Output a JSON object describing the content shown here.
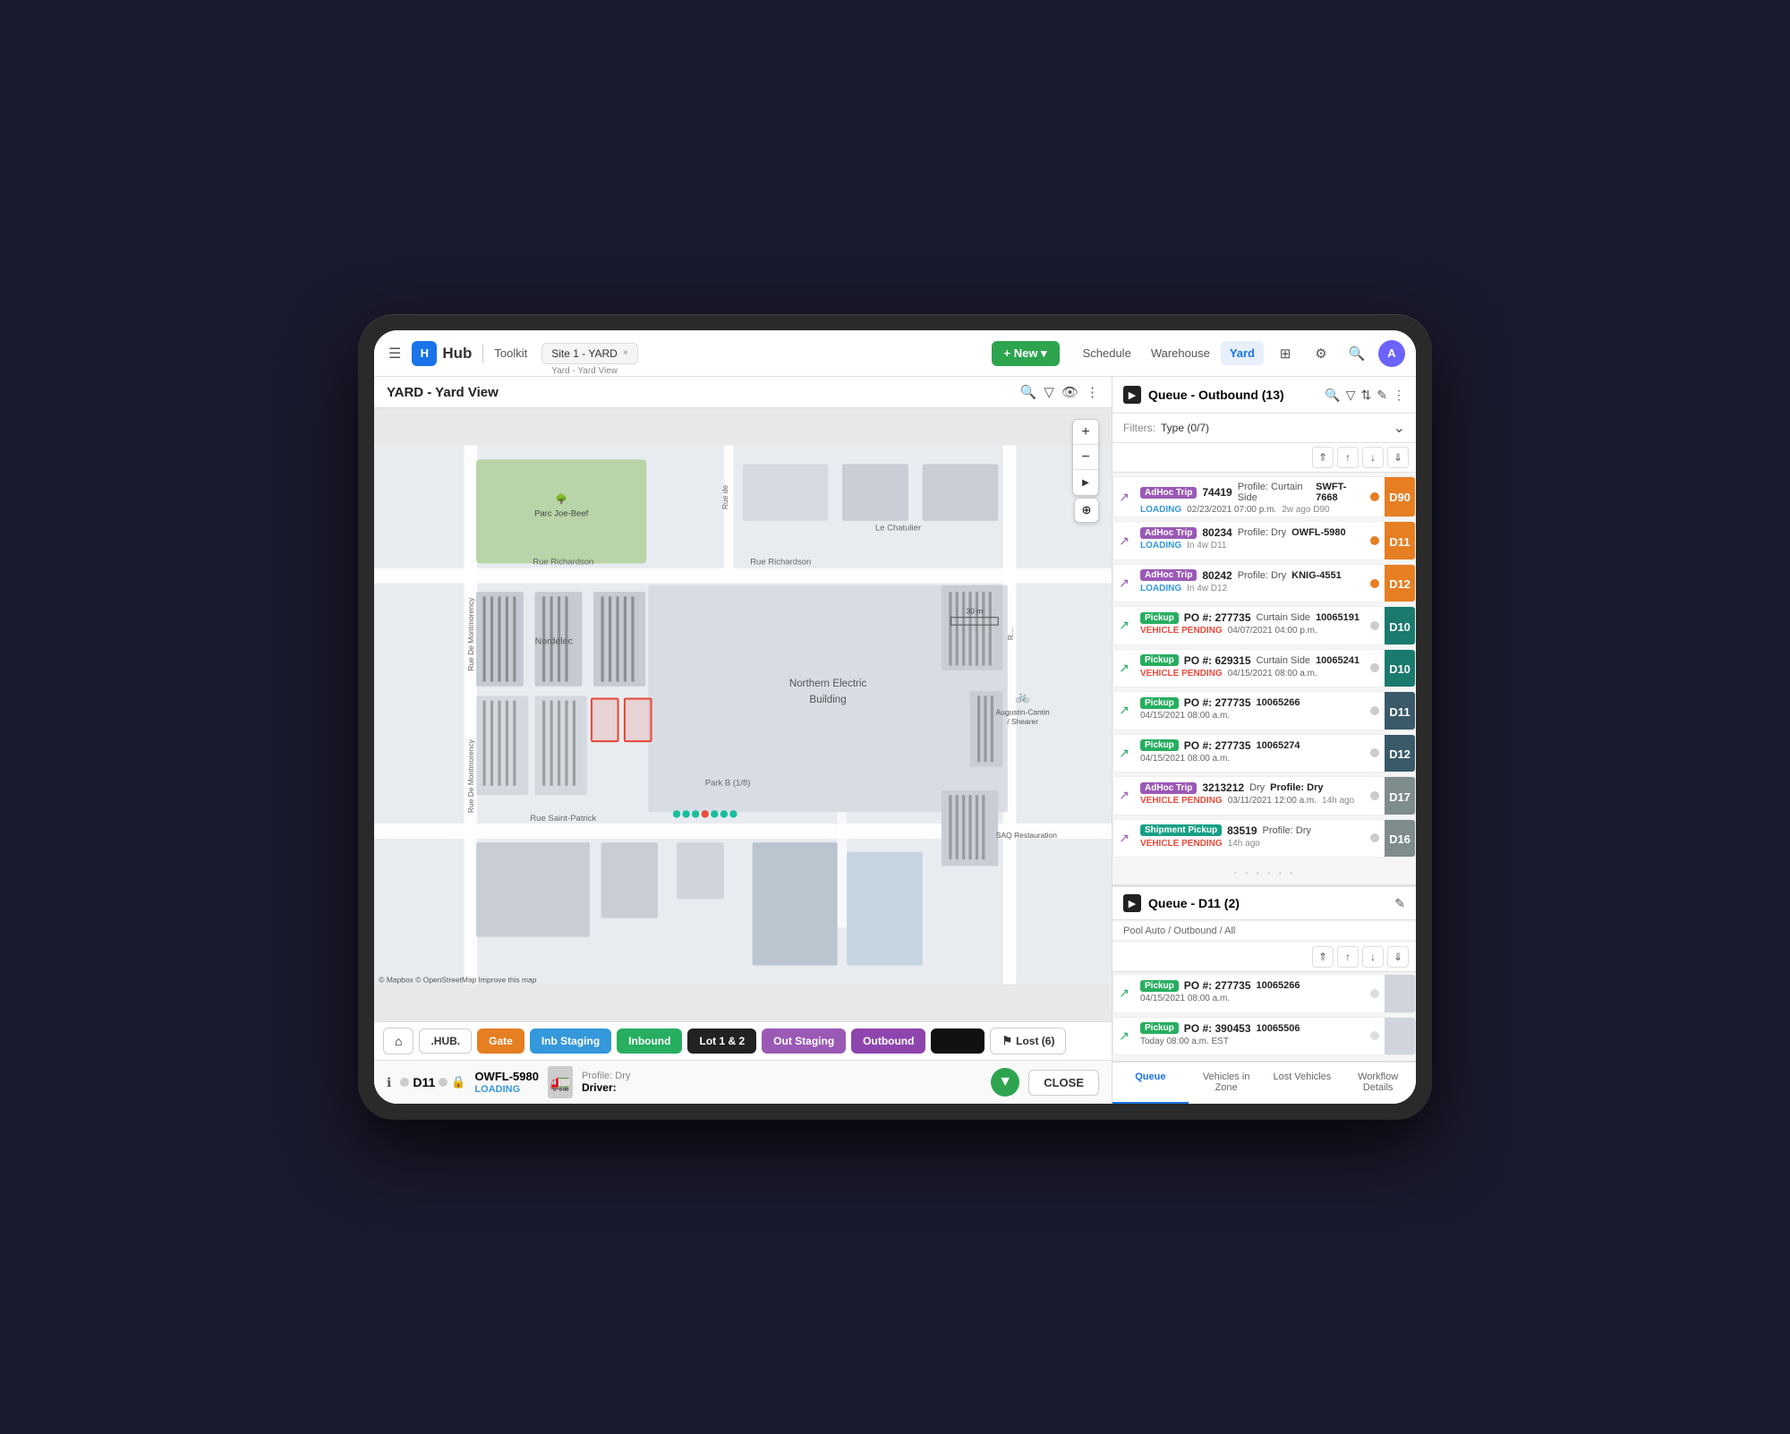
{
  "app": {
    "logo_text": "Hub",
    "toolkit_label": "Toolkit",
    "tab_title": "Site 1 - YARD",
    "tab_sub": "Yard - Yard View",
    "tab_close": "×"
  },
  "nav": {
    "new_label": "+ New ▾",
    "schedule_label": "Schedule",
    "warehouse_label": "Warehouse",
    "yard_label": "Yard",
    "avatar_label": "A"
  },
  "map": {
    "title": "YARD - Yard View",
    "zoom_in": "+",
    "zoom_out": "−",
    "zoom_arrow_r": "▶",
    "gps_icon": "⊕",
    "scale_label": "30 m",
    "park_name": "Parc Joe-Beef",
    "building_main": "Northern Electric Building",
    "building_nordelec": "Nordelec",
    "park_label": "Park B (1/8)",
    "sao_label": "SAQ Restauration",
    "augustin_label": "Augustin-Cantin / Shearer",
    "rue_richardson": "Rue Richardson",
    "rue_saint_patrick": "Rue Saint-Patrick",
    "mapbox_credit": "© Mapbox © OpenStreetMap  Improve this map"
  },
  "bottom_nav": {
    "home_icon": "⌂",
    "hub_label": ".HUB.",
    "gate_label": "Gate",
    "inb_staging_label": "Inb Staging",
    "inbound_label": "Inbound",
    "lot_label": "Lot 1 & 2",
    "out_staging_label": "Out Staging",
    "outbound_label": "Outbound",
    "black_label": "",
    "lost_icon": "⚑",
    "lost_label": "Lost (6)"
  },
  "bottom_info": {
    "dock_label": "D11",
    "owfl_id": "OWFL-5980",
    "owfl_status": "LOADING",
    "profile_label": "Profile: Dry",
    "driver_label": "Driver:",
    "close_label": "CLOSE"
  },
  "queue_outbound": {
    "title": "Queue - Outbound (13)",
    "filter_label": "Filters:",
    "filter_type": "Type (0/7)",
    "items": [
      {
        "type": "AdHoc Trip",
        "type_color": "purple",
        "id": "74419",
        "profile": "Profile: Curtain Side",
        "detail": "SWFT-7668",
        "status": "LOADING",
        "status_type": "loading",
        "date": "02/23/2021 07:00 p.m.",
        "age": "2w ago",
        "dock": "D90",
        "dock_color": "orange",
        "dot_color": "orange"
      },
      {
        "type": "AdHoc Trip",
        "type_color": "purple",
        "id": "80234",
        "profile": "Profile: Dry",
        "detail": "OWFL-5980",
        "status": "LOADING",
        "status_type": "loading",
        "date": "",
        "age": "In 4w",
        "dock": "D11",
        "dock_color": "orange",
        "dot_color": "orange"
      },
      {
        "type": "AdHoc Trip",
        "type_color": "purple",
        "id": "80242",
        "profile": "Profile: Dry",
        "detail": "KNIG-4551",
        "status": "LOADING",
        "status_type": "loading",
        "date": "",
        "age": "In 4w",
        "dock": "D12",
        "dock_color": "orange",
        "dot_color": "orange"
      },
      {
        "type": "Pickup",
        "type_color": "green",
        "id": "",
        "po": "PO #: 277735",
        "profile": "Curtain Side",
        "detail": "10065191",
        "status": "VEHICLE PENDING",
        "status_type": "vehicle-pending",
        "date": "04/07/2021 04:00 p.m.",
        "age": "",
        "dock": "D10",
        "dock_color": "teal",
        "dot_color": "white"
      },
      {
        "type": "Pickup",
        "type_color": "green",
        "id": "",
        "po": "PO #: 629315",
        "profile": "Curtain Side",
        "detail": "10065241",
        "status": "VEHICLE PENDING",
        "status_type": "vehicle-pending",
        "date": "04/15/2021 08:00 a.m.",
        "age": "",
        "dock": "D10",
        "dock_color": "teal",
        "dot_color": "white"
      },
      {
        "type": "Pickup",
        "type_color": "green",
        "id": "",
        "po": "PO #: 277735",
        "profile": "",
        "detail": "10065266",
        "status": "",
        "status_type": "",
        "date": "04/15/2021 08:00 a.m.",
        "age": "",
        "dock": "D11",
        "dock_color": "dark",
        "dot_color": "white"
      },
      {
        "type": "Pickup",
        "type_color": "green",
        "id": "",
        "po": "PO #: 277735",
        "profile": "",
        "detail": "10065274",
        "status": "",
        "status_type": "",
        "date": "04/15/2021 08:00 a.m.",
        "age": "",
        "dock": "D12",
        "dock_color": "dark",
        "dot_color": "white"
      },
      {
        "type": "AdHoc Trip",
        "type_color": "purple",
        "id": "3213212",
        "profile": "Dry",
        "detail": "",
        "po": "Profile: Dry",
        "status": "VEHICLE PENDING",
        "status_type": "vehicle-pending",
        "date": "03/11/2021 12:00 a.m.",
        "age": "14h ago",
        "dock": "D17",
        "dock_color": "gray",
        "dot_color": "white"
      },
      {
        "type": "Shipment Pickup",
        "type_color": "teal",
        "id": "83519",
        "profile": "Profile: Dry",
        "detail": "",
        "status": "VEHICLE PENDING",
        "status_type": "vehicle-pending",
        "date": "",
        "age": "14h ago",
        "dock": "D16",
        "dock_color": "gray",
        "dot_color": "white"
      }
    ]
  },
  "queue_d11": {
    "title": "Queue - D11 (2)",
    "pool_label": "Pool Auto / Outbound / All",
    "items": [
      {
        "type": "Pickup",
        "type_color": "green",
        "po": "PO #: 277735",
        "detail": "10065266",
        "date": "04/15/2021 08:00 a.m.",
        "dock_color": "light"
      },
      {
        "type": "Pickup",
        "type_color": "green",
        "po": "PO #: 390453",
        "detail": "10065506",
        "date": "Today 08:00 a.m. EST",
        "dock_color": "light"
      }
    ]
  },
  "panel_tabs": {
    "queue": "Queue",
    "vehicles_in_zone": "Vehicles in Zone",
    "lost_vehicles": "Lost Vehicles",
    "workflow_details": "Workflow Details"
  }
}
